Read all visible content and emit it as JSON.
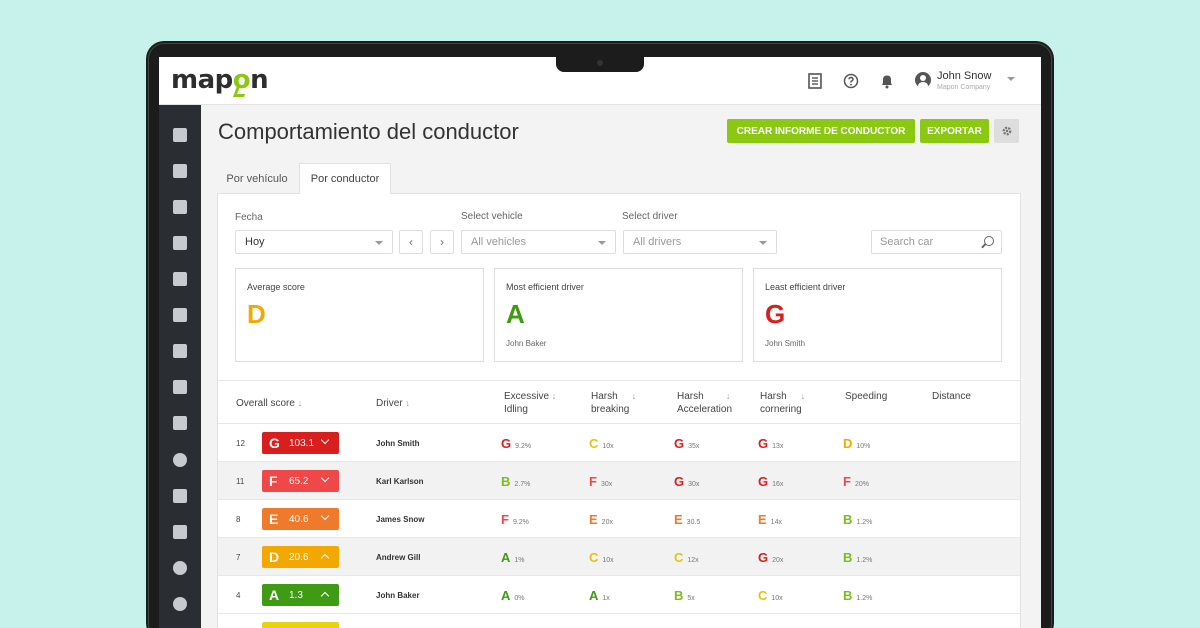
{
  "colors": {
    "accent": "#8ac812",
    "sidebar": "#2a2d32",
    "background": "#c7f2ec",
    "grades": {
      "A": "#3f9a14",
      "B": "#7cbd1b",
      "C": "#e8c20a",
      "D": "#f2a800",
      "E": "#f07a2c",
      "F": "#f04848",
      "G": "#d91e1e"
    }
  },
  "header": {
    "logo": {
      "pre": "map",
      "o": "o",
      "post": "n"
    },
    "icons": [
      "notes-icon",
      "help-icon",
      "bell-icon"
    ],
    "user": {
      "name": "John Snow",
      "company": "Mapon Company"
    }
  },
  "sidebar": {
    "items": [
      "map-icon",
      "dashboard-icon",
      "route-icon",
      "document-icon",
      "alert-icon",
      "fuel-icon",
      "chat-icon",
      "clipboard-icon",
      "car-icon",
      "driver-icon",
      "edit-icon",
      "calendar-icon",
      "settings-icon",
      "tachograph-icon"
    ],
    "active": "driver-icon"
  },
  "page": {
    "title": "Comportamiento del conductor",
    "create_report": "CREAR INFORME DE CONDUCTOR",
    "export": "EXPORTAR"
  },
  "tabs": [
    {
      "label": "Por vehículo"
    },
    {
      "label": "Por conductor",
      "active": true
    }
  ],
  "filters": {
    "date_label": "Fecha",
    "date_value": "Hoy",
    "prev": "‹",
    "next": "›",
    "vehicle_label": "Select vehicle",
    "vehicle_value": "All vehicles",
    "driver_label": "Select driver",
    "driver_value": "All drivers",
    "search_placeholder": "Search car"
  },
  "summary": {
    "average": {
      "title": "Average score",
      "grade": "D"
    },
    "most": {
      "title": "Most efficient driver",
      "grade": "A",
      "name": "John Baker"
    },
    "least": {
      "title": "Least efficient driver",
      "grade": "G",
      "name": "John Smith"
    }
  },
  "table": {
    "headers": {
      "overall": "Overall score",
      "driver": "Driver",
      "idling_1": "Excessive",
      "idling_2": "Idling",
      "breaking_1": "Harsh",
      "breaking_2": "breaking",
      "accel_1": "Harsh",
      "accel_2": "Acceleration",
      "cornering_1": "Harsh",
      "cornering_2": "cornering",
      "speeding": "Speeding",
      "distance": "Distance",
      "sort_arrow": "↓"
    },
    "rows": [
      {
        "rank": "12",
        "grade": "G",
        "score": "103.1",
        "dir": "down",
        "name": "John Smith",
        "idling": {
          "g": "G",
          "v": "9.2%"
        },
        "breaking": {
          "g": "C",
          "v": "10x"
        },
        "accel": {
          "g": "G",
          "v": "35x"
        },
        "cornering": {
          "g": "G",
          "v": "13x"
        },
        "speeding": {
          "g": "D",
          "v": "10%"
        }
      },
      {
        "rank": "11",
        "grade": "F",
        "score": "65.2",
        "dir": "down",
        "name": "Karl Karlson",
        "idling": {
          "g": "B",
          "v": "2.7%"
        },
        "breaking": {
          "g": "F",
          "v": "30x"
        },
        "accel": {
          "g": "G",
          "v": "30x"
        },
        "cornering": {
          "g": "G",
          "v": "16x"
        },
        "speeding": {
          "g": "F",
          "v": "20%"
        }
      },
      {
        "rank": "8",
        "grade": "E",
        "score": "40.6",
        "dir": "down",
        "name": "James Snow",
        "idling": {
          "g": "F",
          "v": "9.2%"
        },
        "breaking": {
          "g": "E",
          "v": "20x"
        },
        "accel": {
          "g": "E",
          "v": "30.5"
        },
        "cornering": {
          "g": "E",
          "v": "14x"
        },
        "speeding": {
          "g": "B",
          "v": "1.2%"
        }
      },
      {
        "rank": "7",
        "grade": "D",
        "score": "20.6",
        "dir": "up",
        "name": "Andrew Gill",
        "idling": {
          "g": "A",
          "v": "1%"
        },
        "breaking": {
          "g": "C",
          "v": "10x"
        },
        "accel": {
          "g": "C",
          "v": "12x"
        },
        "cornering": {
          "g": "G",
          "v": "20x"
        },
        "speeding": {
          "g": "B",
          "v": "1.2%"
        }
      },
      {
        "rank": "4",
        "grade": "A",
        "score": "1.3",
        "dir": "up",
        "name": "John Baker",
        "idling": {
          "g": "A",
          "v": "0%"
        },
        "breaking": {
          "g": "A",
          "v": "1x"
        },
        "accel": {
          "g": "B",
          "v": "5x"
        },
        "cornering": {
          "g": "C",
          "v": "10x"
        },
        "speeding": {
          "g": "B",
          "v": "1.2%"
        }
      }
    ]
  }
}
